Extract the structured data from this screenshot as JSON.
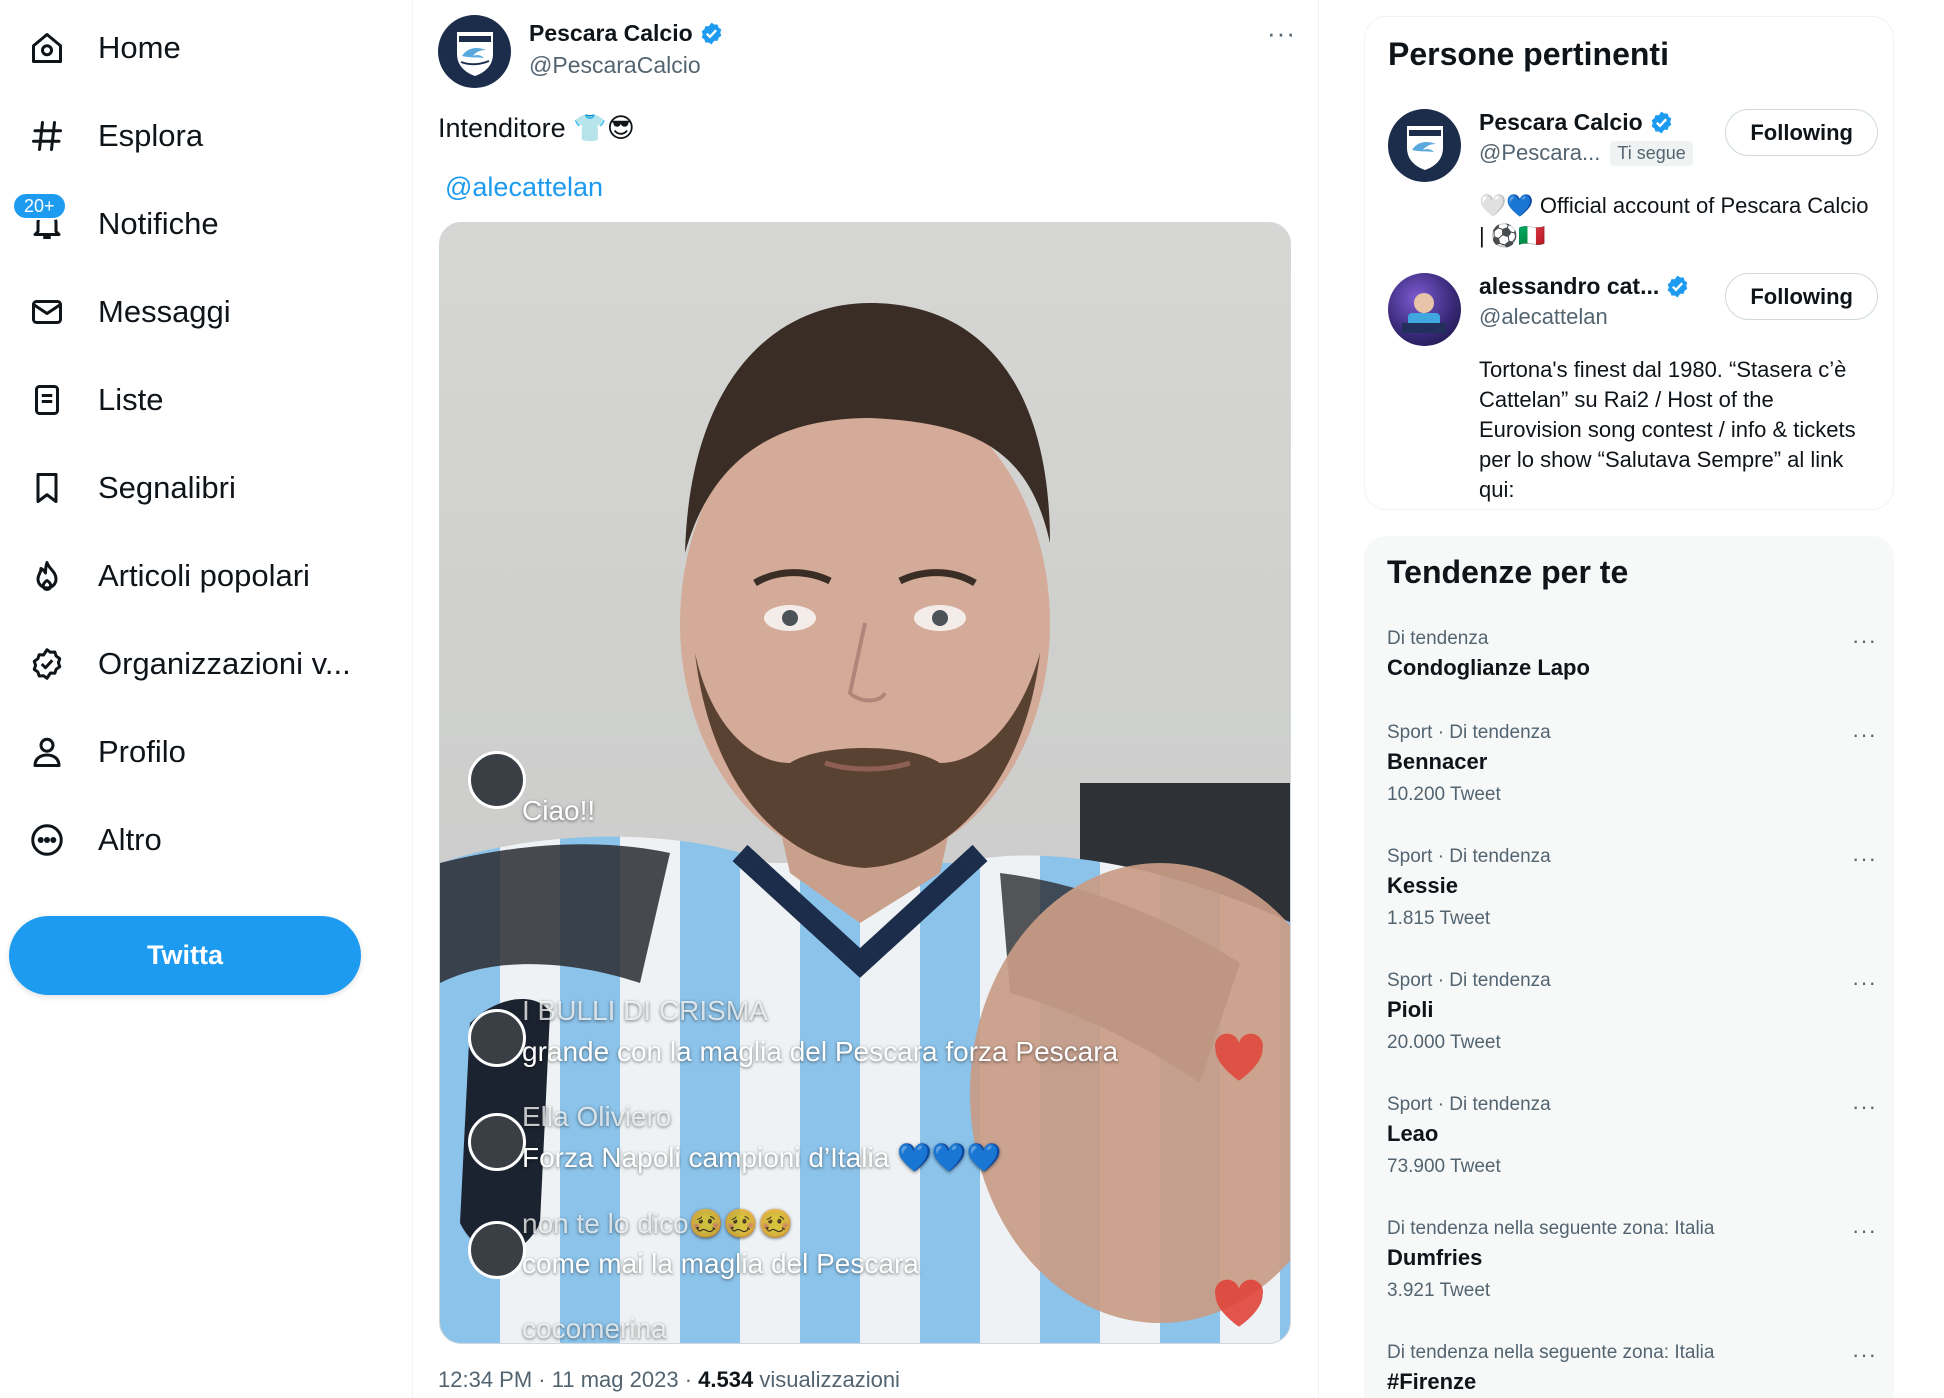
{
  "nav": {
    "items": [
      {
        "label": "Home",
        "icon": "home-icon"
      },
      {
        "label": "Esplora",
        "icon": "hashtag-icon"
      },
      {
        "label": "Notifiche",
        "icon": "bell-icon",
        "badge": "20+"
      },
      {
        "label": "Messaggi",
        "icon": "envelope-icon"
      },
      {
        "label": "Liste",
        "icon": "list-icon"
      },
      {
        "label": "Segnalibri",
        "icon": "bookmark-icon"
      },
      {
        "label": "Articoli popolari",
        "icon": "flame-icon"
      },
      {
        "label": "Organizzazioni v...",
        "icon": "verified-badge-icon"
      },
      {
        "label": "Profilo",
        "icon": "person-icon"
      },
      {
        "label": "Altro",
        "icon": "more-circle-icon"
      }
    ],
    "tweet_button": "Twitta"
  },
  "tweet": {
    "author_name": "Pescara Calcio",
    "author_handle": "@PescaraCalcio",
    "more": "···",
    "text": "Intenditore 👕😎",
    "mention": "@alecattelan",
    "video_comments": [
      {
        "user": "",
        "text": "Ciao!!"
      },
      {
        "user": "I BULLI DI CRISMA",
        "text": "grande con la maglia del Pescara forza Pescara"
      },
      {
        "user": "Ella Oliviero",
        "text": "Forza Napoli campioni d’Italia 💙💙💙"
      },
      {
        "user": "non te lo dico🥴🥴🥴",
        "text": "come mai la maglia del Pescara"
      },
      {
        "user": "cocomerina",
        "text": ""
      }
    ],
    "time": "12:34 PM",
    "date": "11 mag 2023",
    "views": "4.534",
    "views_label": "visualizzazioni",
    "separator": "·"
  },
  "people": {
    "title": "Persone pertinenti",
    "list": [
      {
        "name": "Pescara Calcio",
        "handle": "@Pescara...",
        "follows_you": "Ti segue",
        "button": "Following",
        "bio": "🤍💙 Official account of Pescara Calcio | ⚽🇮🇹"
      },
      {
        "name": "alessandro cat...",
        "handle": "@alecattelan",
        "button": "Following",
        "bio": "Tortona's finest dal 1980. “Stasera c’è Cattelan” su Rai2 / Host of the Eurovision song contest / info & tickets per lo show “Salutava Sempre” al link qui:"
      }
    ]
  },
  "trends": {
    "title": "Tendenze per te",
    "more": "···",
    "list": [
      {
        "context": "Di tendenza",
        "name": "Condoglianze Lapo",
        "count": ""
      },
      {
        "context": "Sport · Di tendenza",
        "name": "Bennacer",
        "count": "10.200 Tweet"
      },
      {
        "context": "Sport · Di tendenza",
        "name": "Kessie",
        "count": "1.815 Tweet"
      },
      {
        "context": "Sport · Di tendenza",
        "name": "Pioli",
        "count": "20.000 Tweet"
      },
      {
        "context": "Sport · Di tendenza",
        "name": "Leao",
        "count": "73.900 Tweet"
      },
      {
        "context": "Di tendenza nella seguente zona: Italia",
        "name": "Dumfries",
        "count": "3.921 Tweet"
      },
      {
        "context": "Di tendenza nella seguente zona: Italia",
        "name": "#Firenze",
        "count": ""
      }
    ]
  },
  "colors": {
    "accent": "#1d9bf0",
    "text": "#0f1419",
    "secondary_text": "#536471",
    "trends_bg": "#f7f9f9"
  }
}
